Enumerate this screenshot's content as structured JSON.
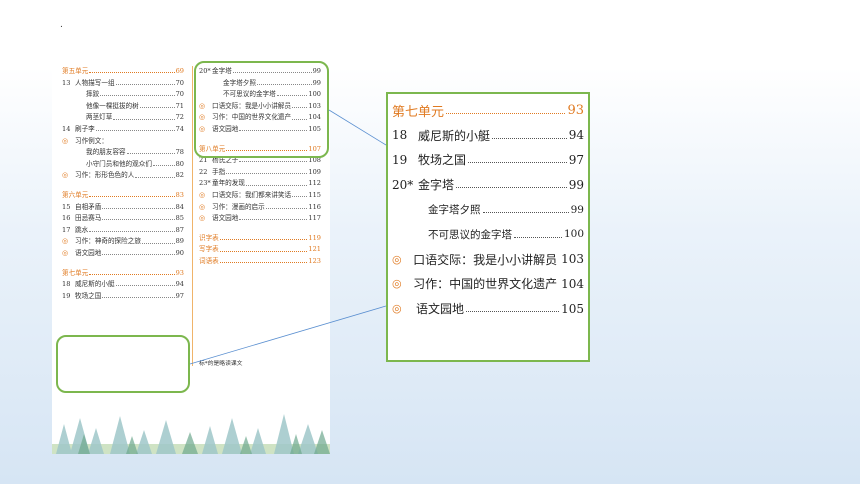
{
  "left_column": [
    {
      "kind": "unit",
      "title": "第五单元",
      "page": "69"
    },
    {
      "kind": "lesson",
      "num": "13",
      "title": "人物描写一组",
      "page": "70"
    },
    {
      "kind": "sub",
      "title": "摔跤",
      "page": "70"
    },
    {
      "kind": "sub",
      "title": "他像一棵挺拔的树",
      "page": "71"
    },
    {
      "kind": "sub",
      "title": "两茎灯草",
      "page": "72"
    },
    {
      "kind": "lesson",
      "num": "14",
      "title": "刷子李",
      "page": "74"
    },
    {
      "kind": "bullet",
      "title": "习作例文：",
      "page": ""
    },
    {
      "kind": "sub",
      "title": "我的朋友容容",
      "page": "78"
    },
    {
      "kind": "sub",
      "title": "小守门员和他的观众们",
      "page": "80"
    },
    {
      "kind": "bullet",
      "title": "习作：形形色色的人",
      "page": "82"
    },
    {
      "kind": "gap"
    },
    {
      "kind": "unit",
      "title": "第六单元",
      "page": "83"
    },
    {
      "kind": "lesson",
      "num": "15",
      "title": "自相矛盾",
      "page": "84"
    },
    {
      "kind": "lesson",
      "num": "16",
      "title": "田忌赛马",
      "page": "85"
    },
    {
      "kind": "lesson",
      "num": "17",
      "title": "跳水",
      "page": "87"
    },
    {
      "kind": "bullet",
      "title": "习作：神奇的探险之旅",
      "page": "89"
    },
    {
      "kind": "bullet",
      "title": "语文园地",
      "page": "90"
    },
    {
      "kind": "gap"
    },
    {
      "kind": "unit",
      "title": "第七单元",
      "page": "93"
    },
    {
      "kind": "lesson",
      "num": "18",
      "title": "威尼斯的小艇",
      "page": "94"
    },
    {
      "kind": "lesson",
      "num": "19",
      "title": "牧场之国",
      "page": "97"
    }
  ],
  "right_column": [
    {
      "kind": "lesson",
      "num": "20*",
      "title": "金字塔",
      "page": "99"
    },
    {
      "kind": "sub",
      "title": "金字塔夕照",
      "page": "99"
    },
    {
      "kind": "sub",
      "title": "不可思议的金字塔",
      "page": "100"
    },
    {
      "kind": "bullet",
      "title": "口语交际：我是小小讲解员",
      "page": "103"
    },
    {
      "kind": "bullet",
      "title": "习作：中国的世界文化遗产",
      "page": "104"
    },
    {
      "kind": "bullet",
      "title": "语文园地",
      "page": "105"
    },
    {
      "kind": "gap"
    },
    {
      "kind": "unit",
      "title": "第八单元",
      "page": "107"
    },
    {
      "kind": "lesson",
      "num": "21",
      "title": "杨氏之子",
      "page": "108"
    },
    {
      "kind": "lesson",
      "num": "22",
      "title": "手指",
      "page": "109"
    },
    {
      "kind": "lesson",
      "num": "23*",
      "title": "童年的发现",
      "page": "112"
    },
    {
      "kind": "bullet",
      "title": "口语交际：我们都来讲笑话",
      "page": "115"
    },
    {
      "kind": "bullet",
      "title": "习作：漫画的启示",
      "page": "116"
    },
    {
      "kind": "bullet",
      "title": "语文园地",
      "page": "117"
    },
    {
      "kind": "gap"
    },
    {
      "kind": "orange",
      "title": "识字表",
      "page": "119"
    },
    {
      "kind": "orange",
      "title": "写字表",
      "page": "121"
    },
    {
      "kind": "orange",
      "title": "词语表",
      "page": "123"
    }
  ],
  "note": "标*的是略读课文",
  "zoom": [
    {
      "kind": "unit",
      "title": "第七单元",
      "page": "93"
    },
    {
      "kind": "lesson",
      "num": "18",
      "title": "威尼斯的小艇",
      "page": "94"
    },
    {
      "kind": "lesson",
      "num": "19",
      "title": "牧场之国",
      "page": "97"
    },
    {
      "kind": "lesson",
      "num": "20*",
      "title": "金字塔",
      "page": "99"
    },
    {
      "kind": "sub",
      "title": "金字塔夕照",
      "page": "99"
    },
    {
      "kind": "sub",
      "title": "不可思议的金字塔",
      "page": "100"
    },
    {
      "kind": "bullet",
      "title": "口语交际：我是小小讲解员",
      "page": "103"
    },
    {
      "kind": "bullet",
      "title": "习作：中国的世界文化遗产",
      "page": "104"
    },
    {
      "kind": "bullet",
      "title": "语文园地",
      "page": "105"
    }
  ],
  "colors": {
    "accent": "#e07a21",
    "highlight": "#7cb74e",
    "connector": "#5a8fd0"
  },
  "bullet_icon": "circle-bullet-icon"
}
